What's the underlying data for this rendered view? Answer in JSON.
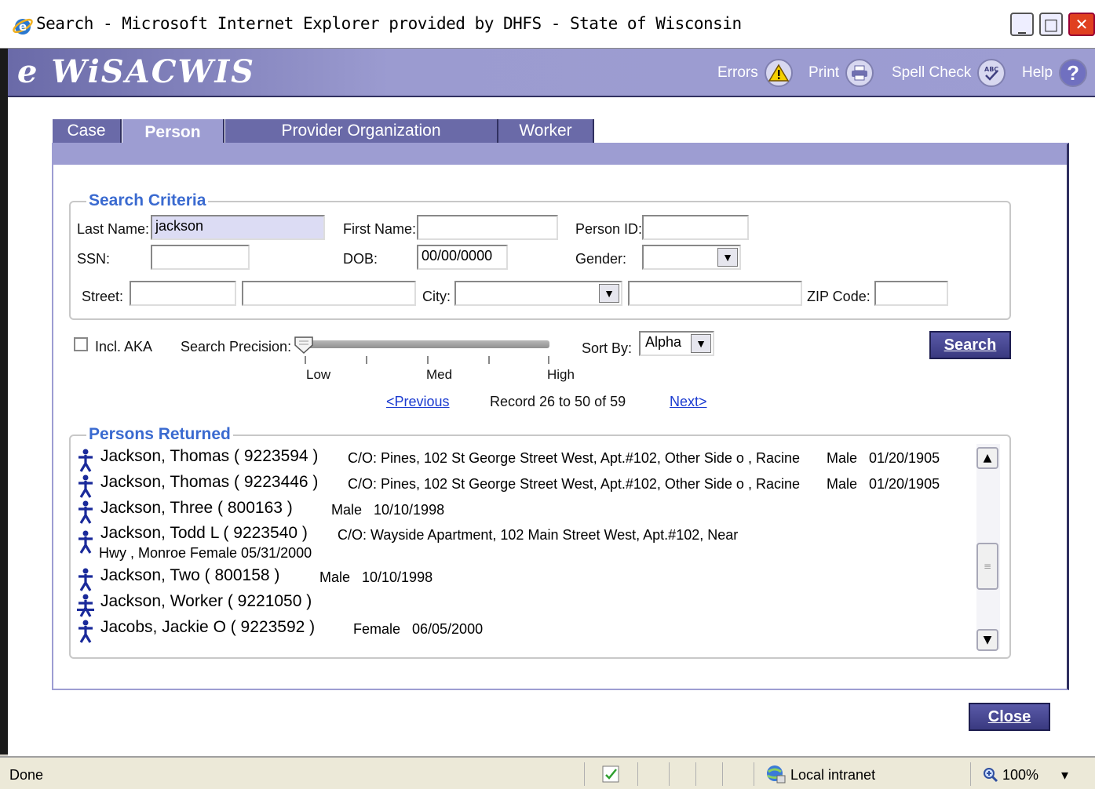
{
  "window": {
    "title": "Search - Microsoft Internet Explorer provided by DHFS - State of Wisconsin",
    "min_glyph": "_",
    "max_glyph": "□",
    "close_glyph": "✕"
  },
  "app": {
    "logo": "e WiSACWIS",
    "toolbar": {
      "errors_label": "Errors",
      "print_label": "Print",
      "spell_check_label": "Spell Check",
      "help_label": "Help"
    }
  },
  "tabs": [
    {
      "label": "Case",
      "active": false
    },
    {
      "label": "Person",
      "active": true
    },
    {
      "label": "Provider Organization",
      "active": false
    },
    {
      "label": "Worker",
      "active": false
    }
  ],
  "criteria": {
    "legend": "Search Criteria",
    "last_name_label": "Last Name:",
    "last_name_value": "jackson",
    "first_name_label": "First Name:",
    "first_name_value": "",
    "person_id_label": "Person ID:",
    "person_id_value": "",
    "ssn_label": "SSN:",
    "ssn_value": "",
    "dob_label": "DOB:",
    "dob_value": "00/00/0000",
    "gender_label": "Gender:",
    "gender_value": "",
    "street_label": "Street:",
    "street_value_1": "",
    "street_value_2": "",
    "city_label": "City:",
    "city_value": "",
    "city_value_2": "",
    "zip_label": "ZIP Code:",
    "zip_value": ""
  },
  "options": {
    "incl_aka_label": "Incl. AKA",
    "incl_aka_checked": false,
    "precision_label": "Search Precision:",
    "precision_low": "Low",
    "precision_med": "Med",
    "precision_high": "High",
    "precision_level": 0,
    "sort_by_label": "Sort By:",
    "sort_by_value": "Alpha",
    "search_button": "Search"
  },
  "pager": {
    "previous": "<Previous",
    "status": "Record 26 to 50 of 59",
    "next": "Next>"
  },
  "results": {
    "legend": "Persons Returned",
    "rows": [
      {
        "name": "Jackson, Thomas ( 9223594 )",
        "detail": "C/O: Pines, 102 St George Street West, Apt.#102, Other Side o , Racine",
        "gender": "Male",
        "dob": "01/20/1905",
        "icon": "person-icon"
      },
      {
        "name": "Jackson, Thomas ( 9223446 )",
        "detail": "C/O: Pines, 102 St George Street West, Apt.#102, Other Side o , Racine",
        "gender": "Male",
        "dob": "01/20/1905",
        "icon": "person-icon"
      },
      {
        "name": "Jackson, Three ( 800163 )",
        "detail": "",
        "gender": "Male",
        "dob": "10/10/1998",
        "icon": "person-icon"
      },
      {
        "name": "Jackson, Todd L ( 9223540 )",
        "detail": "C/O: Wayside Apartment, 102 Main Street West, Apt.#102, Near",
        "detail2": "Hwy , Monroe   Female   05/31/2000",
        "gender": "",
        "dob": "",
        "icon": "person-icon"
      },
      {
        "name": "Jackson, Two ( 800158 )",
        "detail": "",
        "gender": "Male",
        "dob": "10/10/1998",
        "icon": "person-icon"
      },
      {
        "name": "Jackson, Worker ( 9221050 )",
        "detail": "",
        "gender": "",
        "dob": "",
        "icon": "worker-person-icon"
      },
      {
        "name": "Jacobs, Jackie O ( 9223592 )",
        "detail": "",
        "gender": "Female",
        "dob": "06/05/2000",
        "icon": "person-icon"
      }
    ]
  },
  "footer": {
    "close_button": "Close"
  },
  "statusbar": {
    "status_text": "Done",
    "zone": "Local intranet",
    "zoom": "100%",
    "zoom_arrow": "▾"
  },
  "colors": {
    "banner": "#9d9dd2",
    "tab": "#6a6aa8",
    "button": "#3a3a80",
    "legend": "#3a6ad0",
    "icon": "#1a2a9a"
  }
}
